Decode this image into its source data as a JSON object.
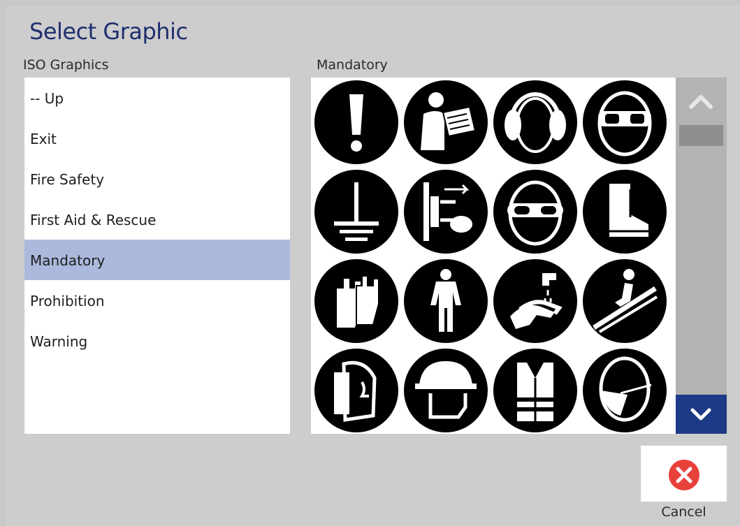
{
  "dialog": {
    "title": "Select Graphic"
  },
  "left_panel": {
    "header": "ISO Graphics",
    "items": [
      {
        "label": "-- Up",
        "selected": false
      },
      {
        "label": "Exit",
        "selected": false
      },
      {
        "label": "Fire Safety",
        "selected": false
      },
      {
        "label": "First Aid & Rescue",
        "selected": false
      },
      {
        "label": "Mandatory",
        "selected": true
      },
      {
        "label": "Prohibition",
        "selected": false
      },
      {
        "label": "Warning",
        "selected": false
      }
    ]
  },
  "right_panel": {
    "header": "Mandatory",
    "graphics": [
      {
        "icon": "general-mandatory-icon"
      },
      {
        "icon": "read-manual-icon"
      },
      {
        "icon": "ear-protection-icon"
      },
      {
        "icon": "eye-protection-icon"
      },
      {
        "icon": "earth-ground-icon"
      },
      {
        "icon": "disconnect-before-maintenance-icon"
      },
      {
        "icon": "safety-goggles-icon"
      },
      {
        "icon": "safety-boots-icon"
      },
      {
        "icon": "protective-gloves-icon"
      },
      {
        "icon": "protective-clothing-icon"
      },
      {
        "icon": "wash-hands-icon"
      },
      {
        "icon": "use-handrail-icon"
      },
      {
        "icon": "face-shield-icon"
      },
      {
        "icon": "hard-hat-icon"
      },
      {
        "icon": "high-visibility-vest-icon"
      },
      {
        "icon": "face-mask-icon"
      }
    ]
  },
  "scrollbar": {
    "up_icon": "chevron-up-icon",
    "down_icon": "chevron-down-icon"
  },
  "cancel": {
    "label": "Cancel",
    "icon": "close-circle-icon",
    "color": "#e8403a"
  },
  "colors": {
    "title": "#1f2f6e",
    "selection": "#aab9dc",
    "scroll_down": "#1d3a86"
  }
}
